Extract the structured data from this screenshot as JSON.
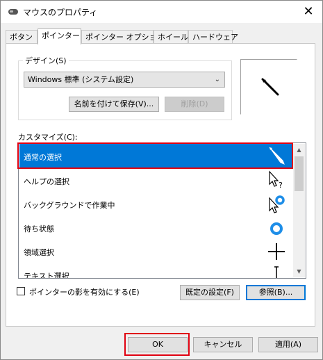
{
  "window": {
    "title": "マウスのプロパティ",
    "close_glyph": "✕"
  },
  "tabs": [
    {
      "label": "ボタン"
    },
    {
      "label": "ポインター",
      "active": true
    },
    {
      "label": "ポインター オプション"
    },
    {
      "label": "ホイール"
    },
    {
      "label": "ハードウェア"
    }
  ],
  "design": {
    "group_label": "デザイン(S)",
    "scheme_value": "Windows 標準 (システム設定)",
    "save_as_label": "名前を付けて保存(V)...",
    "delete_label": "削除(D)"
  },
  "customize": {
    "label": "カスタマイズ(C):",
    "items": [
      {
        "label": "通常の選択",
        "icon": "arrow-cursor-icon",
        "selected": true
      },
      {
        "label": "ヘルプの選択",
        "icon": "help-select-cursor-icon"
      },
      {
        "label": "バックグラウンドで作業中",
        "icon": "working-in-background-cursor-icon"
      },
      {
        "label": "待ち状態",
        "icon": "busy-cursor-icon"
      },
      {
        "label": "領域選択",
        "icon": "precision-select-cursor-icon"
      },
      {
        "label": "テキスト選択",
        "icon": "text-select-cursor-icon"
      }
    ]
  },
  "options": {
    "shadow_label": "ポインターの影を有効にする(E)",
    "shadow_checked": false,
    "default_label": "既定の設定(F)",
    "browse_label": "参照(B)..."
  },
  "footer": {
    "ok_label": "OK",
    "cancel_label": "キャンセル",
    "apply_label": "適用(A)"
  },
  "colors": {
    "selection": "#0078d7",
    "highlight": "#e00010",
    "window_bg": "#f0f0f0"
  }
}
